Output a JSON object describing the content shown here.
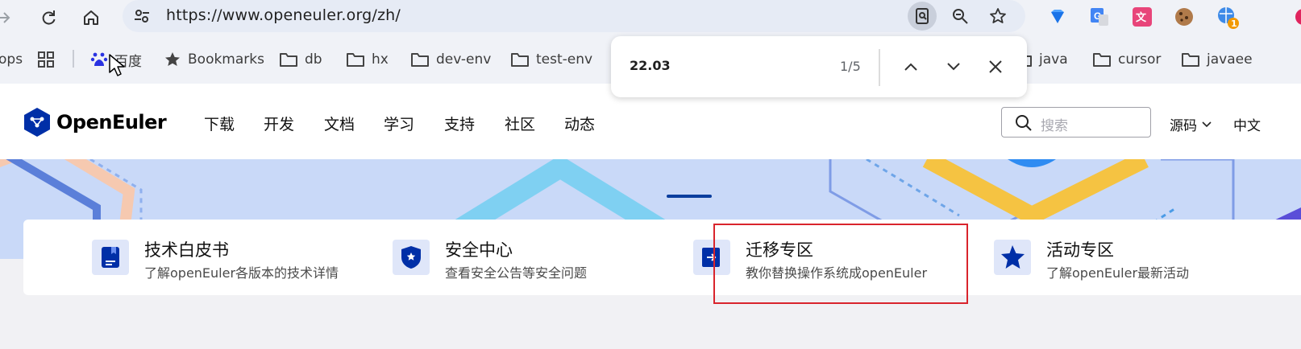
{
  "browser": {
    "url": "https://www.openeuler.org/zh/",
    "extension_badge": "1"
  },
  "bookmarks": {
    "apps_label": "ops",
    "items": [
      {
        "label": "百度",
        "icon": "baidu-icon"
      },
      {
        "label": "Bookmarks",
        "icon": "star-icon"
      },
      {
        "label": "db",
        "icon": "folder-icon"
      },
      {
        "label": "hx",
        "icon": "folder-icon"
      },
      {
        "label": "dev-env",
        "icon": "folder-icon"
      },
      {
        "label": "test-env",
        "icon": "folder-icon"
      },
      {
        "label": "java",
        "icon": "folder-icon"
      },
      {
        "label": "cursor",
        "icon": "folder-icon"
      },
      {
        "label": "javaee",
        "icon": "folder-icon"
      }
    ]
  },
  "find_bar": {
    "query": "22.03",
    "count": "1/5"
  },
  "site": {
    "logo_text": "OpenEuler",
    "nav": [
      "下载",
      "开发",
      "文档",
      "学习",
      "支持",
      "社区",
      "动态"
    ],
    "search_placeholder": "搜索",
    "source_label": "源码",
    "language": "中文"
  },
  "quick_links": [
    {
      "title": "技术白皮书",
      "desc": "了解openEuler各版本的技术详情",
      "icon": "whitepaper-icon"
    },
    {
      "title": "安全中心",
      "desc": "查看安全公告等安全问题",
      "icon": "shield-icon"
    },
    {
      "title": "迁移专区",
      "desc": "教你替换操作系统成openEuler",
      "icon": "migration-icon"
    },
    {
      "title": "活动专区",
      "desc": "了解openEuler最新活动",
      "icon": "star-badge-icon"
    }
  ],
  "colors": {
    "brand_blue": "#0a3e9e",
    "highlight_red": "#d9242c",
    "banner_bg": "#c9d9f8"
  }
}
